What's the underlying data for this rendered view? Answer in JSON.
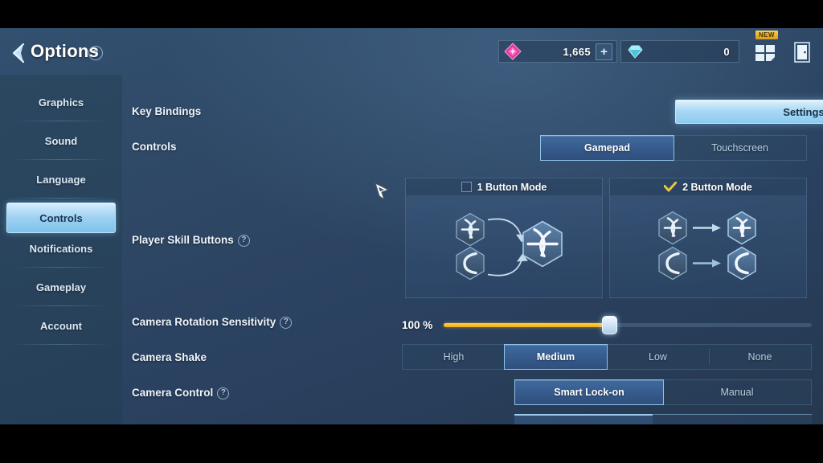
{
  "header": {
    "back_icon": "chevron-left-icon",
    "title": "Options",
    "help_icon": "help-icon",
    "help_label": "?",
    "currencies": [
      {
        "icon": "crystal-gem-icon",
        "value": "1,665",
        "plus_label": "+",
        "has_plus": true
      },
      {
        "icon": "diamond-gem-icon",
        "value": "0",
        "plus_label": "",
        "has_plus": false
      }
    ],
    "menu_grid_icon": "grid-menu-icon",
    "new_badge": "NEW",
    "exit_icon": "exit-door-icon"
  },
  "sidebar": {
    "items": [
      {
        "label": "Graphics",
        "selected": false
      },
      {
        "label": "Sound",
        "selected": false
      },
      {
        "label": "Language",
        "selected": false
      },
      {
        "label": "Controls",
        "selected": true
      },
      {
        "label": "Notifications",
        "selected": false
      },
      {
        "label": "Gameplay",
        "selected": false
      },
      {
        "label": "Account",
        "selected": false
      }
    ]
  },
  "main": {
    "rows": {
      "key_bindings": {
        "label": "Key Bindings",
        "settings_button": "Settings"
      },
      "controls": {
        "label": "Controls",
        "options": [
          {
            "label": "Gamepad",
            "active": true
          },
          {
            "label": "Touchscreen",
            "active": false
          }
        ]
      },
      "player_skill_buttons": {
        "label": "Player Skill Buttons",
        "help_label": "?",
        "modes": [
          {
            "title": "1 Button Mode",
            "selected": false
          },
          {
            "title": "2 Button Mode",
            "selected": true
          }
        ]
      },
      "camera_rotation_sensitivity": {
        "label": "Camera Rotation Sensitivity",
        "help_label": "?",
        "value_text": "100 %",
        "value": 100,
        "fill_percent": 45
      },
      "camera_shake": {
        "label": "Camera Shake",
        "options": [
          {
            "label": "High",
            "active": false
          },
          {
            "label": "Medium",
            "active": true
          },
          {
            "label": "Low",
            "active": false
          },
          {
            "label": "None",
            "active": false
          }
        ]
      },
      "camera_control": {
        "label": "Camera Control",
        "help_label": "?",
        "options": [
          {
            "label": "Smart Lock-on",
            "active": true
          },
          {
            "label": "Manual",
            "active": false
          }
        ]
      }
    }
  },
  "colors": {
    "accent_highlight": "#9fd2f2",
    "slider_fill": "#f0ad15",
    "check_gold": "#e8c43c",
    "gem_magenta": "#e0379c",
    "gem_teal": "#6fd8e8",
    "background": "#2e4865"
  },
  "cursor": {
    "icon": "mouse-pointer-icon"
  }
}
